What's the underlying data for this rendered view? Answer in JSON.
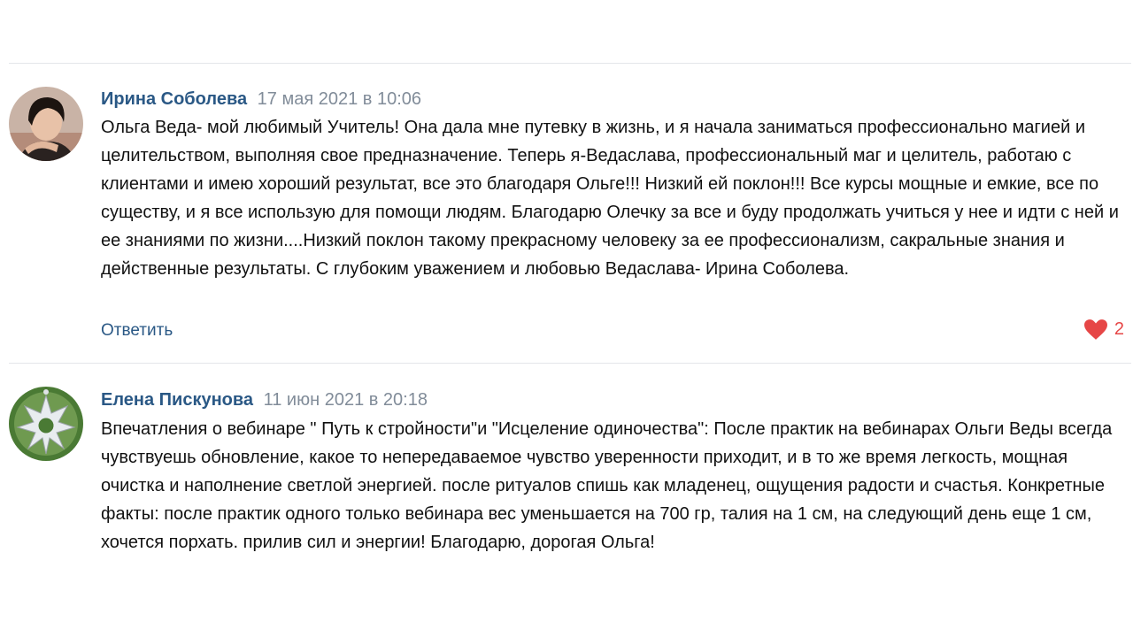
{
  "comments": [
    {
      "author": "Ирина Соболева",
      "date": "17 мая 2021 в 10:06",
      "text": "Ольга Веда- мой любимый Учитель! Она дала мне путевку в жизнь, и я начала заниматься профессионально магией и целительством, выполняя свое предназначение. Теперь я-Ведаслава, профессиональный маг и целитель, работаю с клиентами и имею хороший результат, все это благодаря Ольге!!! Низкий ей поклон!!! Все курсы мощные и емкие, все по существу, и я все использую для помощи людям. Благодарю Олечку за все и буду продолжать учиться у нее и идти с ней и ее знаниями по жизни....Низкий поклон такому прекрасному человеку за ее профессионализм, сакральные знания и действенные результаты. С глубоким уважением и любовью Ведаслава- Ирина Соболева.",
      "reply_label": "Ответить",
      "likes": "2"
    },
    {
      "author": "Елена Пискунова",
      "date": "11 июн 2021 в 20:18",
      "text": "Впечатления о вебинаре \" Путь к стройности\"и \"Исцеление одиночества\": После практик на вебинарах Ольги Веды всегда чувствуешь обновление, какое то непередаваемое чувство уверенности приходит, и в то же время легкость, мощная очистка и наполнение светлой энергией. после ритуалов спишь как младенец, ощущения радости и счастья. Конкретные факты: после практик одного только вебинара вес уменьшается на 700 гр, талия на 1 см, на следующий день еще 1 см, хочется порхать. прилив сил и энергии! Благодарю, дорогая Ольга!"
    }
  ],
  "colors": {
    "link": "#2a5885",
    "date": "#818c99",
    "like": "#e64646",
    "divider": "#e4e6ea"
  }
}
